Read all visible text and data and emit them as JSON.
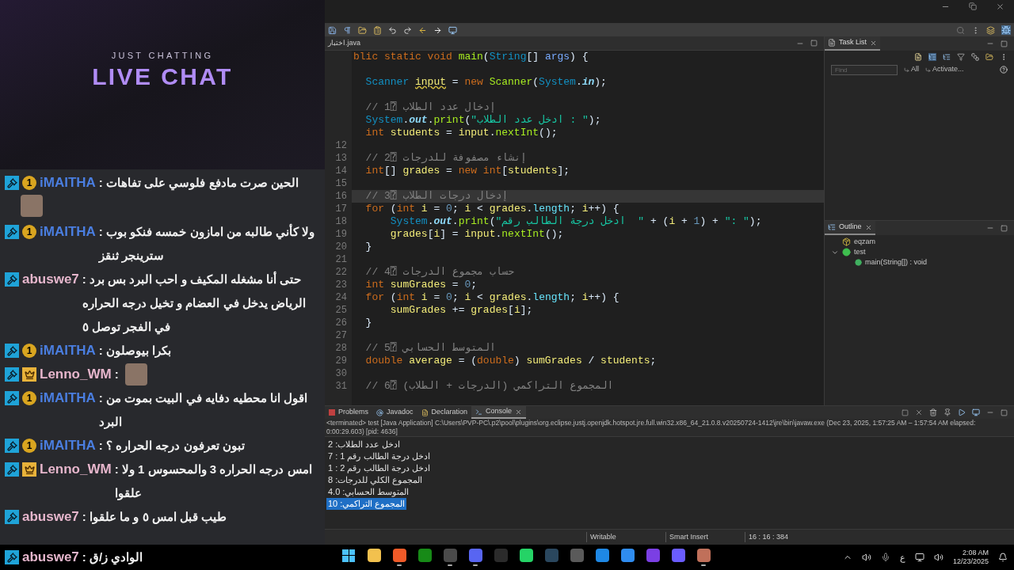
{
  "stream_overlay": {
    "subtitle": "JUST CHATTING",
    "title": "LIVE CHAT"
  },
  "chat": [
    {
      "user": "iMAITHA",
      "color": "#4a7ee0",
      "badges": [
        {
          "kind": "mod"
        },
        {
          "kind": "sub",
          "label": "1"
        }
      ],
      "text": ": الحين صرت مادفع فلوسي على تفاهات",
      "emote": true
    },
    {
      "user": "iMAITHA",
      "color": "#4a7ee0",
      "badges": [
        {
          "kind": "mod"
        },
        {
          "kind": "sub",
          "label": "1"
        }
      ],
      "text": ": ولا كأني طالبه من امازون خمسه فنكو بوب سترينجر ثنقز",
      "emote": false
    },
    {
      "user": "abuswe7",
      "color": "#e6b6cc",
      "badges": [
        {
          "kind": "mod"
        }
      ],
      "text": ": حتى أنا مشغله المكيف و احب البرد بس برد الرياض يدخل في العضام و تخيل درجه الحراره في الفجر توصل ٥",
      "emote": false
    },
    {
      "user": "iMAITHA",
      "color": "#4a7ee0",
      "badges": [
        {
          "kind": "mod"
        },
        {
          "kind": "sub",
          "label": "1"
        }
      ],
      "text": ": بكرا بيوصلون",
      "emote": false
    },
    {
      "user": "Lenno_WM",
      "color": "#e6b6cc",
      "badges": [
        {
          "kind": "mod"
        },
        {
          "kind": "crown"
        }
      ],
      "text": ":",
      "emote": true
    },
    {
      "user": "iMAITHA",
      "color": "#4a7ee0",
      "badges": [
        {
          "kind": "mod"
        },
        {
          "kind": "sub",
          "label": "1"
        }
      ],
      "text": ": اقول انا محطيه دفايه في البيت بموت من البرد",
      "emote": false
    },
    {
      "user": "iMAITHA",
      "color": "#4a7ee0",
      "badges": [
        {
          "kind": "mod"
        },
        {
          "kind": "sub",
          "label": "1"
        }
      ],
      "text": ": تبون تعرفون درجه الحراره ؟",
      "emote": false
    },
    {
      "user": "Lenno_WM",
      "color": "#e6b6cc",
      "badges": [
        {
          "kind": "mod"
        },
        {
          "kind": "crown"
        }
      ],
      "text": ": امس درجه الحراره 3 والمحسوس 1 ولا علقوا",
      "emote": false
    },
    {
      "user": "abuswe7",
      "color": "#e6b6cc",
      "badges": [
        {
          "kind": "mod"
        }
      ],
      "text": ": طيب قبل امس ٥ و ما علقوا",
      "emote": false
    },
    {
      "user": "abuswe7",
      "color": "#e6b6cc",
      "badges": [
        {
          "kind": "mod"
        }
      ],
      "text": ": الوادي ز/ق",
      "emote": false
    }
  ],
  "editor": {
    "tab": "اختبار.java",
    "lines": [
      {
        "current": false,
        "tokens": [
          {
            "kind": "kw",
            "text": "blic static void "
          },
          {
            "kind": "method",
            "text": "main"
          },
          {
            "kind": "plain",
            "text": "("
          },
          {
            "kind": "type",
            "text": "String"
          },
          {
            "kind": "plain",
            "text": "[] "
          },
          {
            "kind": "param",
            "text": "args"
          },
          {
            "kind": "plain",
            "text": ") {"
          }
        ]
      },
      {
        "current": false
      },
      {
        "current": false,
        "tokens": [
          {
            "kind": "type",
            "text": "  Scanner "
          },
          {
            "kind": "warn_var",
            "text": "input"
          },
          {
            "kind": "plain",
            "text": " = "
          },
          {
            "kind": "kw",
            "text": "new "
          },
          {
            "kind": "method",
            "text": "Scanner"
          },
          {
            "kind": "plain",
            "text": "("
          },
          {
            "kind": "type",
            "text": "System"
          },
          {
            "kind": "plain",
            "text": "."
          },
          {
            "kind": "static",
            "text": "in"
          },
          {
            "kind": "plain",
            "text": ");"
          }
        ]
      },
      {
        "current": false
      },
      {
        "current": false,
        "tokens": [
          {
            "kind": "comment",
            "text": "  // 1⍰ إدخال عدد الطلاب"
          }
        ]
      },
      {
        "current": false,
        "tokens": [
          {
            "kind": "type",
            "text": "  System"
          },
          {
            "kind": "plain",
            "text": "."
          },
          {
            "kind": "static",
            "text": "out"
          },
          {
            "kind": "plain",
            "text": "."
          },
          {
            "kind": "method",
            "text": "print"
          },
          {
            "kind": "plain",
            "text": "("
          },
          {
            "kind": "str",
            "text": "\"ادخل عدد الطلاب : \""
          },
          {
            "kind": "plain",
            "text": ");"
          }
        ]
      },
      {
        "current": false,
        "tokens": [
          {
            "kind": "kw",
            "text": "  int "
          },
          {
            "kind": "var",
            "text": "students"
          },
          {
            "kind": "plain",
            "text": " = "
          },
          {
            "kind": "var",
            "text": "input"
          },
          {
            "kind": "plain",
            "text": "."
          },
          {
            "kind": "method",
            "text": "nextInt"
          },
          {
            "kind": "plain",
            "text": "();"
          }
        ]
      },
      {
        "number": "12",
        "current": false
      },
      {
        "number": "13",
        "current": false,
        "tokens": [
          {
            "kind": "comment",
            "text": "  // 2⍰ إنشاء مصفوفة للدرجات"
          }
        ]
      },
      {
        "number": "14",
        "current": false,
        "tokens": [
          {
            "kind": "kw",
            "text": "  int"
          },
          {
            "kind": "plain",
            "text": "[] "
          },
          {
            "kind": "var",
            "text": "grades"
          },
          {
            "kind": "plain",
            "text": " = "
          },
          {
            "kind": "kw",
            "text": "new int"
          },
          {
            "kind": "plain",
            "text": "["
          },
          {
            "kind": "var",
            "text": "students"
          },
          {
            "kind": "plain",
            "text": "];"
          }
        ]
      },
      {
        "number": "15",
        "current": false
      },
      {
        "number": "16",
        "current": true,
        "tokens": [
          {
            "kind": "comment",
            "text": "  // 3⍰ إدخال درجات الطلاب"
          }
        ]
      },
      {
        "number": "17",
        "current": false,
        "tokens": [
          {
            "kind": "kw",
            "text": "  for "
          },
          {
            "kind": "plain",
            "text": "("
          },
          {
            "kind": "kw",
            "text": "int "
          },
          {
            "kind": "var",
            "text": "i"
          },
          {
            "kind": "plain",
            "text": " = "
          },
          {
            "kind": "num",
            "text": "0"
          },
          {
            "kind": "plain",
            "text": "; "
          },
          {
            "kind": "var",
            "text": "i"
          },
          {
            "kind": "plain",
            "text": " < "
          },
          {
            "kind": "var",
            "text": "grades"
          },
          {
            "kind": "plain",
            "text": "."
          },
          {
            "kind": "field",
            "text": "length"
          },
          {
            "kind": "plain",
            "text": "; "
          },
          {
            "kind": "var",
            "text": "i"
          },
          {
            "kind": "plain",
            "text": "++) {"
          }
        ]
      },
      {
        "number": "18",
        "current": false,
        "tokens": [
          {
            "kind": "type",
            "text": "      System"
          },
          {
            "kind": "plain",
            "text": "."
          },
          {
            "kind": "static",
            "text": "out"
          },
          {
            "kind": "plain",
            "text": "."
          },
          {
            "kind": "method",
            "text": "print"
          },
          {
            "kind": "plain",
            "text": "("
          },
          {
            "kind": "str",
            "text": "\"ادخل درجة الطالب رقم  \""
          },
          {
            "kind": "plain",
            "text": " + ("
          },
          {
            "kind": "var",
            "text": "i"
          },
          {
            "kind": "plain",
            "text": " + "
          },
          {
            "kind": "num",
            "text": "1"
          },
          {
            "kind": "plain",
            "text": ") + "
          },
          {
            "kind": "str",
            "text": "\": \""
          },
          {
            "kind": "plain",
            "text": ");"
          }
        ]
      },
      {
        "number": "19",
        "current": false,
        "tokens": [
          {
            "kind": "var",
            "text": "      grades"
          },
          {
            "kind": "plain",
            "text": "["
          },
          {
            "kind": "var",
            "text": "i"
          },
          {
            "kind": "plain",
            "text": "] = "
          },
          {
            "kind": "var",
            "text": "input"
          },
          {
            "kind": "plain",
            "text": "."
          },
          {
            "kind": "method",
            "text": "nextInt"
          },
          {
            "kind": "plain",
            "text": "();"
          }
        ]
      },
      {
        "number": "20",
        "current": false,
        "tokens": [
          {
            "kind": "plain",
            "text": "  }"
          }
        ]
      },
      {
        "number": "21",
        "current": false
      },
      {
        "number": "22",
        "current": false,
        "tokens": [
          {
            "kind": "comment",
            "text": "  // 4⍰ حساب مجموع الدرجات"
          }
        ]
      },
      {
        "number": "23",
        "current": false,
        "tokens": [
          {
            "kind": "kw",
            "text": "  int "
          },
          {
            "kind": "var",
            "text": "sumGrades"
          },
          {
            "kind": "plain",
            "text": " = "
          },
          {
            "kind": "num",
            "text": "0"
          },
          {
            "kind": "plain",
            "text": ";"
          }
        ]
      },
      {
        "number": "24",
        "current": false,
        "tokens": [
          {
            "kind": "kw",
            "text": "  for "
          },
          {
            "kind": "plain",
            "text": "("
          },
          {
            "kind": "kw",
            "text": "int "
          },
          {
            "kind": "var",
            "text": "i"
          },
          {
            "kind": "plain",
            "text": " = "
          },
          {
            "kind": "num",
            "text": "0"
          },
          {
            "kind": "plain",
            "text": "; "
          },
          {
            "kind": "var",
            "text": "i"
          },
          {
            "kind": "plain",
            "text": " < "
          },
          {
            "kind": "var",
            "text": "grades"
          },
          {
            "kind": "plain",
            "text": "."
          },
          {
            "kind": "field",
            "text": "length"
          },
          {
            "kind": "plain",
            "text": "; "
          },
          {
            "kind": "var",
            "text": "i"
          },
          {
            "kind": "plain",
            "text": "++) {"
          }
        ]
      },
      {
        "number": "25",
        "current": false,
        "tokens": [
          {
            "kind": "var",
            "text": "      sumGrades"
          },
          {
            "kind": "plain",
            "text": " += "
          },
          {
            "kind": "var",
            "text": "grades"
          },
          {
            "kind": "plain",
            "text": "["
          },
          {
            "kind": "var",
            "text": "i"
          },
          {
            "kind": "plain",
            "text": "];"
          }
        ]
      },
      {
        "number": "26",
        "current": false,
        "tokens": [
          {
            "kind": "plain",
            "text": "  }"
          }
        ]
      },
      {
        "number": "27",
        "current": false
      },
      {
        "number": "28",
        "current": false,
        "tokens": [
          {
            "kind": "comment",
            "text": "  // 5⍰ المتوسط الحسابي"
          }
        ]
      },
      {
        "number": "29",
        "current": false,
        "tokens": [
          {
            "kind": "kw",
            "text": "  double "
          },
          {
            "kind": "var",
            "text": "average"
          },
          {
            "kind": "plain",
            "text": " = ("
          },
          {
            "kind": "kw",
            "text": "double"
          },
          {
            "kind": "plain",
            "text": ") "
          },
          {
            "kind": "var",
            "text": "sumGrades"
          },
          {
            "kind": "plain",
            "text": " / "
          },
          {
            "kind": "var",
            "text": "students"
          },
          {
            "kind": "plain",
            "text": ";"
          }
        ]
      },
      {
        "number": "30",
        "current": false
      },
      {
        "number": "31",
        "current": false,
        "tokens": [
          {
            "kind": "comment",
            "text": "  // 6⍰ المجموع التراكمي (الدرجات + الطلاب)"
          }
        ]
      }
    ]
  },
  "task_list": {
    "tab": "Task List",
    "find_placeholder": "Find",
    "filters": [
      "All",
      "Activate..."
    ]
  },
  "outline": {
    "tab": "Outline",
    "tree": [
      {
        "label": "eqzam",
        "kind": "package"
      },
      {
        "label": "test",
        "kind": "class",
        "expanded": true,
        "children": [
          {
            "label": "main(String[]) : void",
            "kind": "method"
          }
        ]
      }
    ]
  },
  "console": {
    "tabs": [
      {
        "label": "Problems",
        "selected": false
      },
      {
        "label": "Javadoc",
        "selected": false
      },
      {
        "label": "Declaration",
        "selected": false
      },
      {
        "label": "Console",
        "selected": true
      }
    ],
    "status": "<terminated> test [Java Application] C:\\Users\\PVP-PC\\.p2\\pool\\plugins\\org.eclipse.justj.openjdk.hotspot.jre.full.win32.x86_64_21.0.8.v20250724-1412\\jre\\bin\\javaw.exe  (Dec 23, 2025, 1:57:25 AM – 1:57:54 AM elapsed: 0:00:29.603) [pid: 4636]",
    "lines": [
      {
        "text": "ادخل عدد الطلاب: 2",
        "selected": false
      },
      {
        "text": "ادخل درجة الطالب رقم 1 : 7",
        "selected": false
      },
      {
        "text": "ادخل درجة الطالب رقم 2 : 1",
        "selected": false
      },
      {
        "text": "المجموع الكلي للدرجات: 8",
        "selected": false
      },
      {
        "text": "المتوسط الحسابي: 4.0",
        "selected": false
      },
      {
        "text": "المجموع التراكمي: 10",
        "selected": true
      }
    ]
  },
  "status_bar": [
    "Writable",
    "Smart Insert",
    "16 : 16 : 384"
  ],
  "taskbar": {
    "apps": [
      {
        "kind": "start",
        "running": false
      },
      {
        "kind": "app",
        "color": "#f2c14e",
        "running": false
      },
      {
        "kind": "app",
        "color": "#f05a28",
        "running": true
      },
      {
        "kind": "app",
        "color": "#178a17",
        "running": false
      },
      {
        "kind": "app",
        "color": "#4a4a4a",
        "running": true
      },
      {
        "kind": "app",
        "color": "#5865f2",
        "running": true
      },
      {
        "kind": "app",
        "color": "#2b2b2b",
        "running": false
      },
      {
        "kind": "app",
        "color": "#25d366",
        "running": false
      },
      {
        "kind": "app",
        "color": "#2a475e",
        "running": false
      },
      {
        "kind": "app",
        "color": "#5a5a5a",
        "running": false
      },
      {
        "kind": "app",
        "color": "#1e88e5",
        "running": false
      },
      {
        "kind": "app",
        "color": "#2f8cf0",
        "running": false
      },
      {
        "kind": "app",
        "color": "#7b3fe4",
        "running": false
      },
      {
        "kind": "app",
        "color": "#6a5cff",
        "running": false
      },
      {
        "kind": "app",
        "color": "#c0705a",
        "running": true
      }
    ],
    "language": "ع",
    "time": "2:08 AM",
    "date": "12/23/2025"
  }
}
